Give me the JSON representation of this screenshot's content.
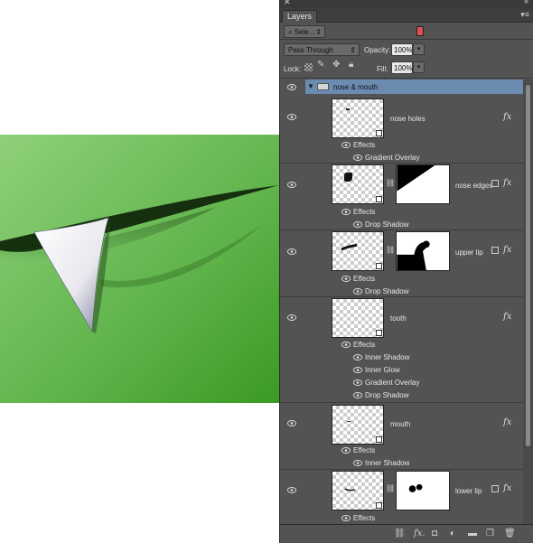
{
  "panel": {
    "tab_label": "Layers",
    "filter_label": "Sele...",
    "blend_mode": "Pass Through",
    "opacity_label": "Opacity:",
    "opacity_value": "100%",
    "lock_label": "Lock:",
    "fill_label": "Fill:",
    "fill_value": "100%"
  },
  "layers": {
    "group_name": "nose & mouth",
    "nose_holes": {
      "name": "nose holes",
      "effects_label": "Effects",
      "effects": [
        "Gradient Overlay"
      ]
    },
    "nose_edges": {
      "name": "nose edges",
      "effects_label": "Effects",
      "effects": [
        "Drop Shadow"
      ]
    },
    "upper_lip": {
      "name": "upper lip",
      "effects_label": "Effects",
      "effects": [
        "Drop Shadow"
      ]
    },
    "tooth": {
      "name": "tooth",
      "effects_label": "Effects",
      "effects": [
        "Inner Shadow",
        "Inner Glow",
        "Gradient Overlay",
        "Drop Shadow"
      ]
    },
    "mouth": {
      "name": "mouth",
      "effects_label": "Effects",
      "effects": [
        "Inner Shadow"
      ]
    },
    "lower_lip": {
      "name": "lower lip",
      "effects_label": "Effects"
    }
  },
  "fx_glyph": "fx",
  "colors": {
    "panel_bg": "#535353",
    "group_highlight": "#6b8bb0",
    "canvas_green": "#5fb34a",
    "filter_swatch": "#e05050"
  },
  "icons": [
    "close-icon",
    "collapse-icon",
    "panel-menu-icon",
    "search-icon",
    "eye-icon",
    "folder-icon",
    "link-icon",
    "fx-icon",
    "mask-icon",
    "adjustment-icon",
    "new-group-icon",
    "new-layer-icon",
    "trash-icon"
  ]
}
